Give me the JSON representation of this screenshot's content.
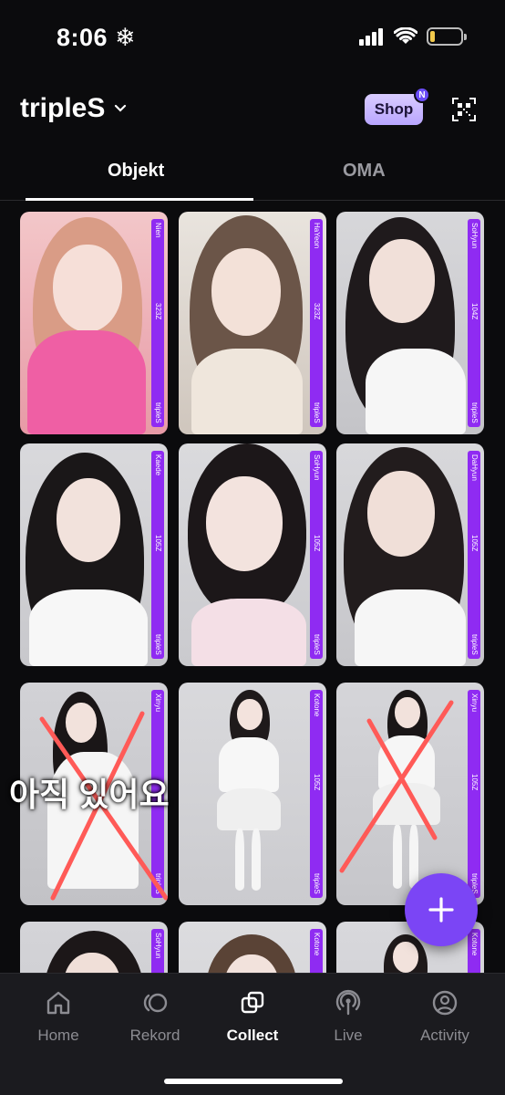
{
  "status_bar": {
    "time": "8:06 ❄",
    "battery_level": 0.15
  },
  "header": {
    "brand": "tripleS",
    "shop_label": "Shop",
    "shop_badge": "N"
  },
  "tabs": [
    {
      "label": "Objekt",
      "active": true
    },
    {
      "label": "OMA",
      "active": false
    }
  ],
  "cards": [
    {
      "member": "Nien",
      "serial": "323Z",
      "group": "tripleS"
    },
    {
      "member": "HaYeon",
      "serial": "323Z",
      "group": "tripleS"
    },
    {
      "member": "SoHyun",
      "serial": "104Z",
      "group": "tripleS"
    },
    {
      "member": "Kaede",
      "serial": "105Z",
      "group": "tripleS"
    },
    {
      "member": "SoHyun",
      "serial": "105Z",
      "group": "tripleS"
    },
    {
      "member": "DaHyun",
      "serial": "105Z",
      "group": "tripleS"
    },
    {
      "member": "Xinyu",
      "serial": "",
      "group": "tripleS"
    },
    {
      "member": "Kotone",
      "serial": "105Z",
      "group": "tripleS"
    },
    {
      "member": "Xinyu",
      "serial": "105Z",
      "group": "tripleS"
    },
    {
      "member": "SoHyun",
      "serial": "",
      "group": ""
    },
    {
      "member": "Kotone",
      "serial": "",
      "group": ""
    },
    {
      "member": "Kotone",
      "serial": "",
      "group": ""
    }
  ],
  "overlay_text": "아직 있어요",
  "bottom_nav": [
    {
      "label": "Home",
      "icon": "home-icon",
      "active": false
    },
    {
      "label": "Rekord",
      "icon": "rekord-icon",
      "active": false
    },
    {
      "label": "Collect",
      "icon": "collect-icon",
      "active": true
    },
    {
      "label": "Live",
      "icon": "live-icon",
      "active": false
    },
    {
      "label": "Activity",
      "icon": "activity-icon",
      "active": false
    }
  ],
  "colors": {
    "background": "#0b0b0d",
    "accent": "#7b45f5",
    "card_strip": "#8f2bf2",
    "nav_bg": "#1b1b1f"
  }
}
